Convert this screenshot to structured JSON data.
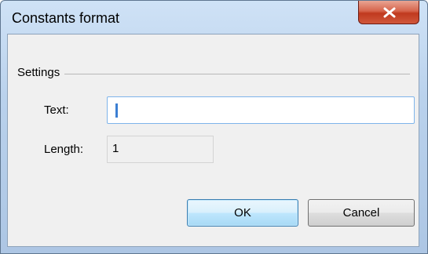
{
  "window": {
    "title": "Constants format"
  },
  "settings": {
    "group_label": "Settings",
    "text_label": "Text:",
    "text_value": "",
    "length_label": "Length:",
    "length_value": "1"
  },
  "buttons": {
    "ok": "OK",
    "cancel": "Cancel"
  },
  "icons": {
    "close": "close-icon"
  },
  "colors": {
    "close_button": "#c7432a",
    "focus_border": "#7eb4ea",
    "ok_border": "#3c7fb1"
  }
}
